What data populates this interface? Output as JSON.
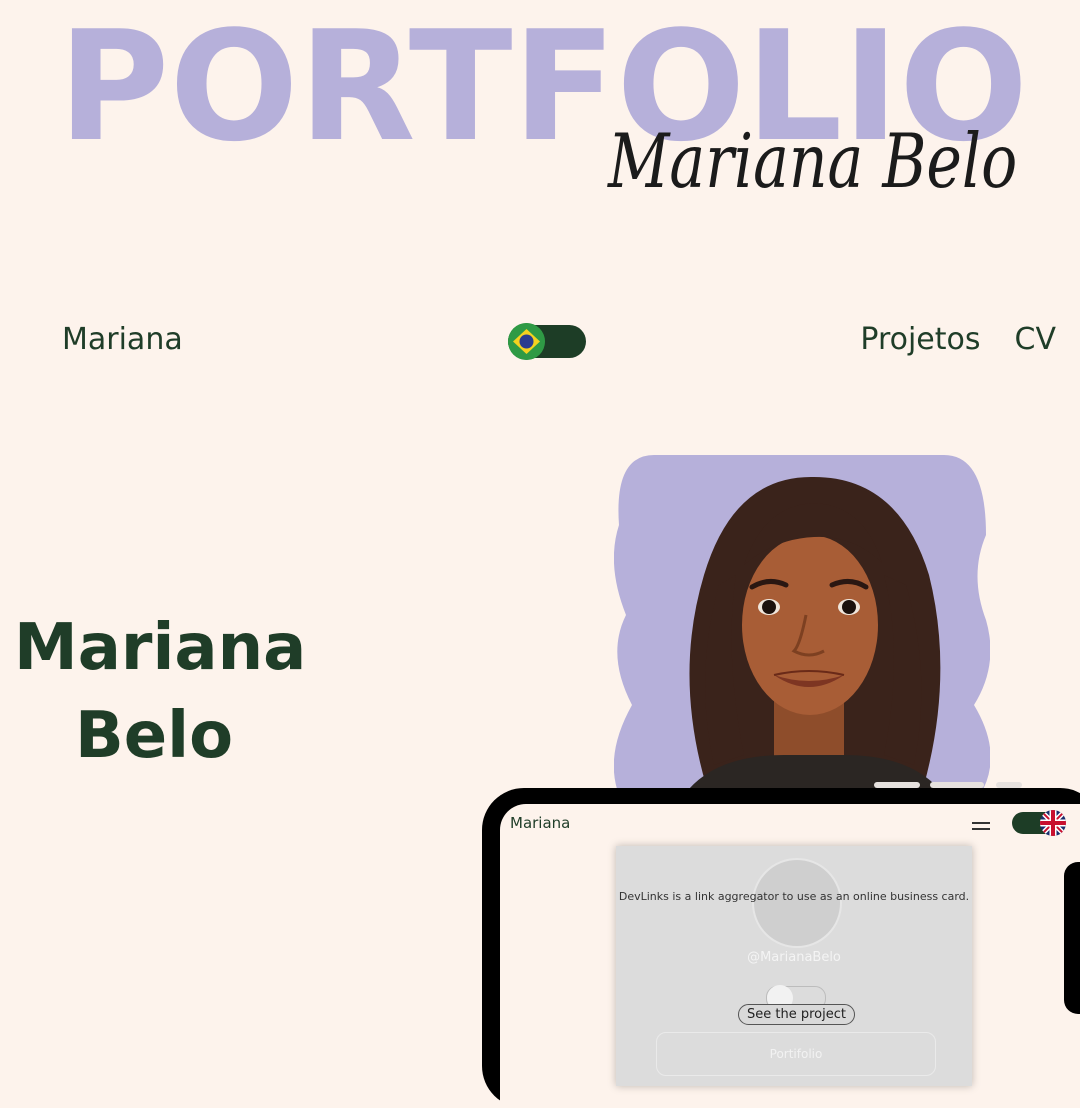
{
  "headline": "PORTFOLIO",
  "signature": "Mariana Belo",
  "navbar": {
    "brand": "Mariana",
    "links": [
      "Projetos",
      "CV"
    ],
    "language_toggle": {
      "flag": "brazil-flag-icon",
      "language": "pt-BR"
    }
  },
  "hero": {
    "first_name": "Mariana",
    "last_name": "Belo",
    "avatar": "illustrated-portrait"
  },
  "mobile": {
    "brand": "Mariana",
    "language_toggle": {
      "flag": "uk-flag-icon",
      "language": "en"
    },
    "card": {
      "description": "DevLinks is a link aggregator to use as an online business card.",
      "handle": "@MarianaBelo",
      "cta": "See the project",
      "button": "Portifolio"
    }
  },
  "colors": {
    "background": "#fdf3ec",
    "headline": "#b6b0da",
    "text": "#1f3d28",
    "accent": "#1d3d26"
  }
}
